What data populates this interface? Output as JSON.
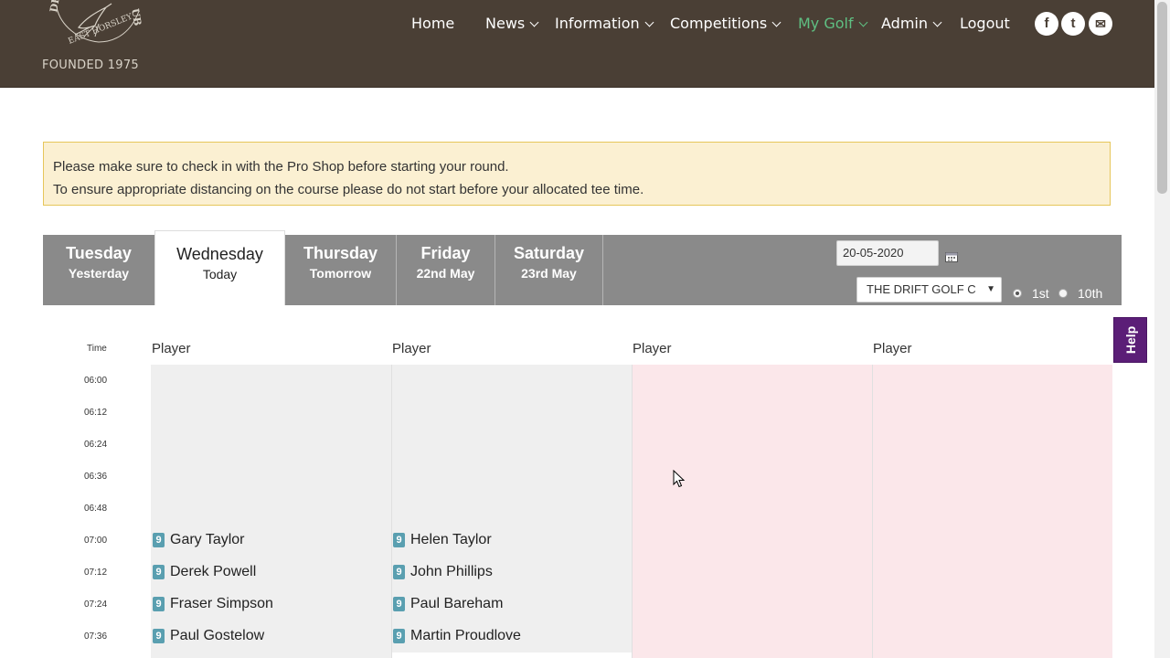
{
  "header": {
    "club_arc_top": "DR",
    "club_arc_right": "UB",
    "club_arc_bottom": "EAST HORSLEY",
    "founded": "FOUNDED 1975",
    "nav": [
      {
        "label": "Home",
        "dropdown": false,
        "active": false
      },
      {
        "label": "News",
        "dropdown": true,
        "active": false
      },
      {
        "label": "Information",
        "dropdown": true,
        "active": false
      },
      {
        "label": "Competitions",
        "dropdown": true,
        "active": false
      },
      {
        "label": "My Golf",
        "dropdown": true,
        "active": true
      },
      {
        "label": "Admin",
        "dropdown": true,
        "active": false
      },
      {
        "label": "Logout",
        "dropdown": false,
        "active": false
      }
    ],
    "social": [
      {
        "icon": "facebook-icon",
        "glyph": "f"
      },
      {
        "icon": "twitter-icon",
        "glyph": "t"
      },
      {
        "icon": "email-icon",
        "glyph": "✉"
      }
    ],
    "colors": {
      "background": "#4a3f35",
      "active_nav": "#5fbf82"
    }
  },
  "notice": {
    "line1": "Please make sure to check in with the Pro Shop before starting your round.",
    "line2": "To ensure appropriate distancing on the course please do not start before your allocated tee time."
  },
  "days": [
    {
      "day": "Tuesday",
      "sub": "Yesterday",
      "active": false
    },
    {
      "day": "Wednesday",
      "sub": "Today",
      "active": true
    },
    {
      "day": "Thursday",
      "sub": "Tomorrow",
      "active": false
    },
    {
      "day": "Friday",
      "sub": "22nd May",
      "active": false
    },
    {
      "day": "Saturday",
      "sub": "23rd May",
      "active": false
    }
  ],
  "controls": {
    "date_value": "20-05-2020",
    "course_selected": "THE DRIFT GOLF C",
    "tee_options": [
      {
        "label": "1st",
        "checked": true
      },
      {
        "label": "10th",
        "checked": false
      }
    ]
  },
  "help_label": "Help",
  "teesheet": {
    "time_header": "Time",
    "player_headers": [
      "Player",
      "Player",
      "Player",
      "Player"
    ],
    "times": [
      "06:00",
      "06:12",
      "06:24",
      "06:36",
      "06:48",
      "07:00",
      "07:12",
      "07:24",
      "07:36"
    ],
    "rows": [
      {
        "time": "07:00",
        "players": [
          {
            "name": "Gary Taylor",
            "badge": "9"
          },
          {
            "name": "Helen Taylor",
            "badge": "9"
          }
        ]
      },
      {
        "time": "07:12",
        "players": [
          {
            "name": "Derek Powell",
            "badge": "9"
          },
          {
            "name": "John Phillips",
            "badge": "9"
          }
        ]
      },
      {
        "time": "07:24",
        "players": [
          {
            "name": "Fraser Simpson",
            "badge": "9"
          },
          {
            "name": "Paul Bareham",
            "badge": "9"
          }
        ]
      },
      {
        "time": "07:36",
        "players": [
          {
            "name": "Paul Gostelow",
            "badge": "9"
          },
          {
            "name": "Martin Proudlove",
            "badge": "9"
          }
        ]
      }
    ],
    "colors": {
      "booked_column": "#efefef",
      "blocked_column": "#fbe7ea",
      "badge": "#5a9fb0"
    }
  }
}
